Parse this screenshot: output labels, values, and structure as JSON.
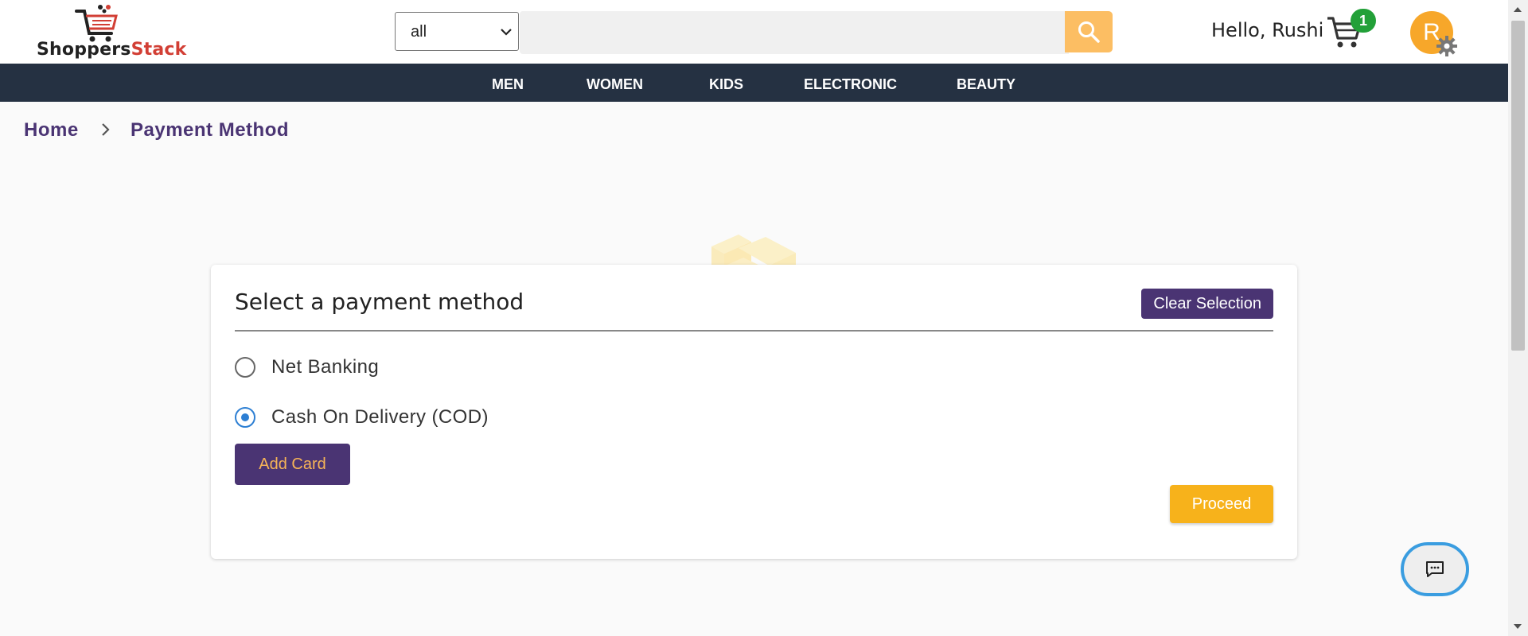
{
  "header": {
    "logo": {
      "part1": "Shoppers",
      "part2": "Stack"
    },
    "search": {
      "category": "all",
      "placeholder": ""
    },
    "greeting": "Hello, Rushi",
    "cart_count": "1",
    "avatar_letter": "R"
  },
  "nav": {
    "items": [
      "MEN",
      "WOMEN",
      "KIDS",
      "ELECTRONIC",
      "BEAUTY"
    ]
  },
  "breadcrumb": {
    "home": "Home",
    "current": "Payment Method"
  },
  "payment": {
    "title": "Select a payment method",
    "clear_label": "Clear Selection",
    "options": [
      {
        "label": "Net Banking",
        "checked": false
      },
      {
        "label": "Cash On Delivery (COD)",
        "checked": true
      }
    ],
    "add_card_label": "Add Card",
    "proceed_label": "Proceed"
  },
  "colors": {
    "brand_purple": "#4a3473",
    "accent_yellow": "#f7b21b",
    "navbar_bg": "#253142",
    "search_btn": "#fcbe63",
    "cart_badge": "#22a038",
    "avatar": "#f7a72a"
  },
  "icons": {
    "logo": "shopping-cart-logo-icon",
    "search": "search-icon",
    "cart": "cart-icon",
    "gear": "gear-icon",
    "chat": "chat-icon",
    "breadcrumb_sep": "chevron-right-icon"
  }
}
